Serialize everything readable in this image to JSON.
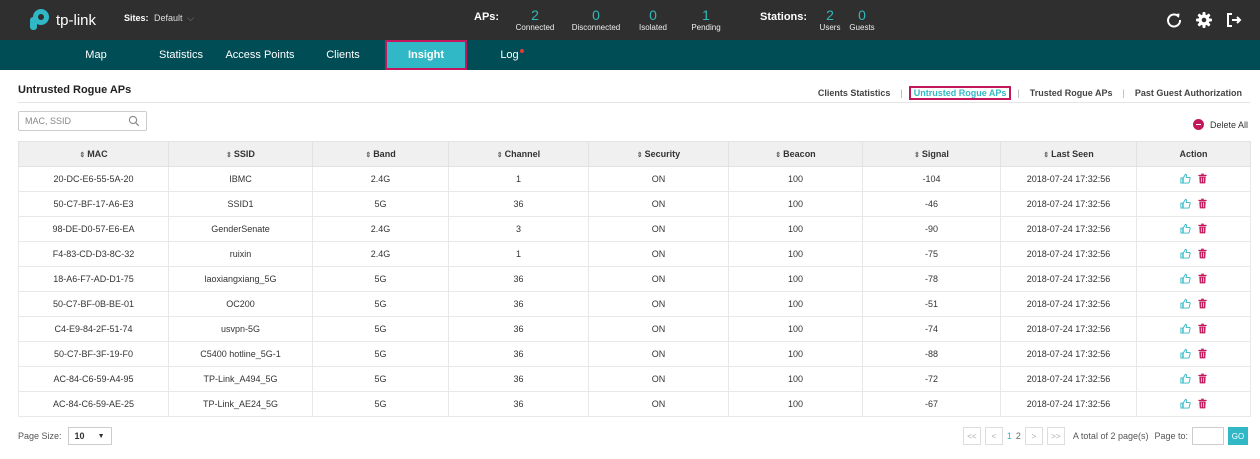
{
  "header": {
    "logo_text": "tp-link",
    "sites_label": "Sites:",
    "sites_value": "Default",
    "aps_label": "APs:",
    "aps": [
      {
        "num": "2",
        "label": "Connected"
      },
      {
        "num": "0",
        "label": "Disconnected"
      },
      {
        "num": "0",
        "label": "Isolated"
      },
      {
        "num": "1",
        "label": "Pending"
      }
    ],
    "stations_label": "Stations:",
    "stations": [
      {
        "num": "2",
        "label": "Users"
      },
      {
        "num": "0",
        "label": "Guests"
      }
    ],
    "icons": [
      "refresh-icon",
      "gear-icon",
      "logout-icon"
    ]
  },
  "nav": {
    "items": [
      "Map",
      "Statistics",
      "Access Points",
      "Clients",
      "Insight",
      "Log"
    ],
    "active": "Insight"
  },
  "page": {
    "title": "Untrusted Rogue APs",
    "subtabs": [
      "Clients Statistics",
      "Untrusted Rogue APs",
      "Trusted Rogue APs",
      "Past Guest Authorization"
    ],
    "active_subtab": "Untrusted Rogue APs",
    "search_placeholder": "MAC, SSID",
    "delete_all_label": "Delete All"
  },
  "table": {
    "columns": [
      "MAC",
      "SSID",
      "Band",
      "Channel",
      "Security",
      "Beacon",
      "Signal",
      "Last Seen",
      "Action"
    ],
    "rows": [
      [
        "20-DC-E6-55-5A-20",
        "IBMC",
        "2.4G",
        "1",
        "ON",
        "100",
        "-104",
        "2018-07-24 17:32:56"
      ],
      [
        "50-C7-BF-17-A6-E3",
        "SSID1",
        "5G",
        "36",
        "ON",
        "100",
        "-46",
        "2018-07-24 17:32:56"
      ],
      [
        "98-DE-D0-57-E6-EA",
        "GenderSenate",
        "2.4G",
        "3",
        "ON",
        "100",
        "-90",
        "2018-07-24 17:32:56"
      ],
      [
        "F4-83-CD-D3-8C-32",
        "ruixin",
        "2.4G",
        "1",
        "ON",
        "100",
        "-75",
        "2018-07-24 17:32:56"
      ],
      [
        "18-A6-F7-AD-D1-75",
        "laoxiangxiang_5G",
        "5G",
        "36",
        "ON",
        "100",
        "-78",
        "2018-07-24 17:32:56"
      ],
      [
        "50-C7-BF-0B-BE-01",
        "OC200",
        "5G",
        "36",
        "ON",
        "100",
        "-51",
        "2018-07-24 17:32:56"
      ],
      [
        "C4-E9-84-2F-51-74",
        "usvpn-5G",
        "5G",
        "36",
        "ON",
        "100",
        "-74",
        "2018-07-24 17:32:56"
      ],
      [
        "50-C7-BF-3F-19-F0",
        "C5400 hotline_5G-1",
        "5G",
        "36",
        "ON",
        "100",
        "-88",
        "2018-07-24 17:32:56"
      ],
      [
        "AC-84-C6-59-A4-95",
        "TP-Link_A494_5G",
        "5G",
        "36",
        "ON",
        "100",
        "-72",
        "2018-07-24 17:32:56"
      ],
      [
        "AC-84-C6-59-AE-25",
        "TP-Link_AE24_5G",
        "5G",
        "36",
        "ON",
        "100",
        "-67",
        "2018-07-24 17:32:56"
      ]
    ]
  },
  "footer": {
    "page_size_label": "Page Size:",
    "page_size_value": "10",
    "pages": [
      "1",
      "2"
    ],
    "first_label": "<<",
    "prev_label": "<",
    "next_label": ">",
    "last_label": ">>",
    "total_text": "A total of 2 page(s)",
    "page_to_label": "Page to:",
    "go_label": "GO"
  },
  "colors": {
    "accent": "#30b8c6",
    "nav_bg": "#004d55",
    "header_bg": "#2f2f2f",
    "highlight_border": "#c2185b",
    "delete": "#c2185b"
  }
}
